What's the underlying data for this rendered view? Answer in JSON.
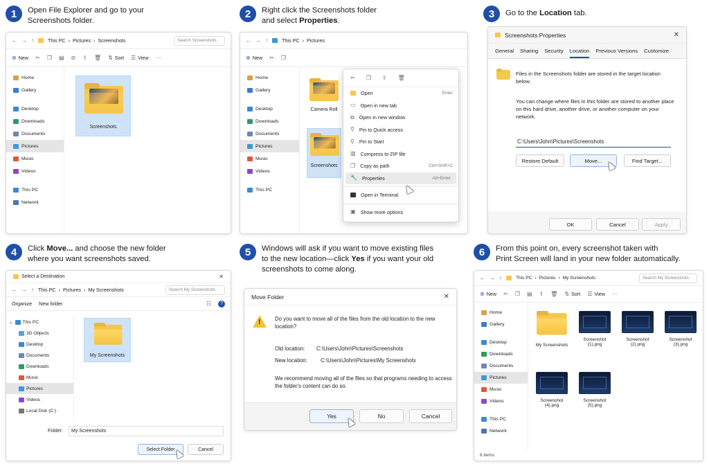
{
  "colors": {
    "accent": "#1f4fa8",
    "folder": "#f5c74d",
    "selection": "#cfe3f8"
  },
  "steps": [
    {
      "num": "1",
      "line1": "Open File Explorer and go to your",
      "line2": "Screenshots folder."
    },
    {
      "num": "2",
      "line1": "Right click the Screenshots folder",
      "line2_pre": "and select ",
      "line2_bold": "Properties",
      "line2_post": "."
    },
    {
      "num": "3",
      "line1_pre": "Go to the ",
      "line1_bold": "Location",
      "line1_post": " tab."
    },
    {
      "num": "4",
      "line1_pre": "Click ",
      "line1_bold": "Move...",
      "line1_post": " and choose the new folder",
      "line2": "where you want screenshots saved."
    },
    {
      "num": "5",
      "line1": "Windows will ask if you want to move existing files",
      "line2_pre": "to the new location—click ",
      "line2_bold": "Yes",
      "line2_post": " if you want your old",
      "line3": "screenshots to come along."
    },
    {
      "num": "6",
      "line1": "From this point on, every screenshot taken with",
      "line2": "Print Screen will land in your new folder automatically."
    }
  ],
  "panel1": {
    "crumbs": [
      "This PC",
      "Pictures",
      "Screenshots"
    ],
    "search_placeholder": "Search Screenshots",
    "new_label": "New",
    "sort_label": "Sort",
    "view_label": "View",
    "nav": [
      "Home",
      "Gallery",
      "Desktop",
      "Downloads",
      "Documents",
      "Pictures",
      "Music",
      "Videos",
      "This PC",
      "Network"
    ],
    "folder_label": "Screenshots"
  },
  "panel2": {
    "crumbs": [
      "This PC",
      "Pictures"
    ],
    "new_label": "New",
    "nav": [
      "Home",
      "Gallery",
      "Desktop",
      "Downloads",
      "Documents",
      "Pictures",
      "Music",
      "Videos",
      "This PC"
    ],
    "folders": [
      "Camera Roll",
      "Screenshots"
    ],
    "menu": [
      {
        "label": "Open",
        "shortcut": "Enter"
      },
      {
        "label": "Open in new tab",
        "shortcut": ""
      },
      {
        "label": "Open in new window",
        "shortcut": ""
      },
      {
        "label": "Pin to Quick access",
        "shortcut": ""
      },
      {
        "label": "Pin to Start",
        "shortcut": ""
      },
      {
        "label": "Compress to ZIP file",
        "shortcut": ""
      },
      {
        "label": "Copy as path",
        "shortcut": "Ctrl+Shift+C"
      },
      {
        "label": "Properties",
        "shortcut": "Alt+Enter"
      },
      {
        "label": "Open in Terminal",
        "shortcut": ""
      },
      {
        "label": "Show more options",
        "shortcut": ""
      }
    ]
  },
  "panel3": {
    "title": "Screenshots Properties",
    "tabs": [
      "General",
      "Sharing",
      "Security",
      "Location",
      "Previous Versions",
      "Customize"
    ],
    "info": "Files in the Screenshots folder are stored in the target location below.",
    "desc": "You can change where files in this folder are stored to another place on this hard drive, another drive, or another computer on your network.",
    "path": "C:\\Users\\John\\Pictures\\Screenshots",
    "restore": "Restore Default",
    "move": "Move...",
    "find": "Find Target...",
    "ok": "OK",
    "cancel": "Cancel",
    "apply": "Apply"
  },
  "panel4": {
    "title": "Select a Destination",
    "crumbs": [
      "This PC",
      "Pictures",
      "My Screenshots"
    ],
    "search_placeholder": "Search My Screenshots",
    "organize": "Organize",
    "new_folder": "New folder",
    "tree": [
      "This PC",
      "3D Objects",
      "Desktop",
      "Documents",
      "Downloads",
      "Music",
      "Pictures",
      "Videos",
      "Local Disk (C:)"
    ],
    "folder_label": "My Screenshots",
    "folder_field_label": "Folder:",
    "folder_field_value": "My Screenshots",
    "select_btn": "Select Folder",
    "cancel_btn": "Cancel"
  },
  "panel5": {
    "title": "Move Folder",
    "question": "Do you want to move all of the files from the old location to the new location?",
    "old_label": "Old location:",
    "old_value": "C:\\Users\\John\\Pictures\\Screenshots",
    "new_label": "New location:",
    "new_value": "C:\\Users\\John\\Pictures\\My Screenshots",
    "recommend": "We recommend moving all of the files so that programs needing to access the folder's content can do so.",
    "yes": "Yes",
    "no": "No",
    "cancel": "Cancel"
  },
  "panel6": {
    "crumbs": [
      "This PC",
      "Pictures",
      "My Screenshots"
    ],
    "search_placeholder": "Search My Screenshots",
    "new_label": "New",
    "sort_label": "Sort",
    "view_label": "View",
    "nav": [
      "Home",
      "Gallery",
      "Desktop",
      "Downloads",
      "Documents",
      "Pictures",
      "Music",
      "Videos",
      "This PC",
      "Network"
    ],
    "items": [
      "My Screenshots",
      "Screenshot (1).png",
      "Screenshot (2).png",
      "Screenshot (3).png",
      "Screenshot (4).png",
      "Screenshot (5).png"
    ],
    "status": "6 items"
  }
}
